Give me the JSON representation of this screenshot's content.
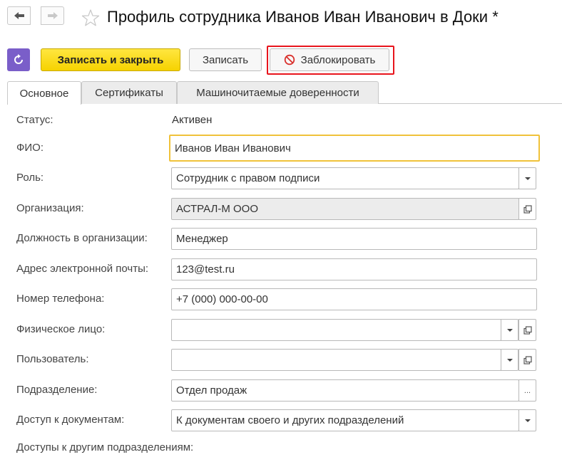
{
  "window": {
    "title": "Профиль сотрудника Иванов Иван Иванович в Доки *"
  },
  "toolbar": {
    "save_close_label": "Записать и закрыть",
    "save_label": "Записать",
    "block_label": "Заблокировать"
  },
  "tabs": [
    {
      "label": "Основное",
      "active": true
    },
    {
      "label": "Сертификаты",
      "active": false
    },
    {
      "label": "Машиночитаемые доверенности",
      "active": false
    }
  ],
  "form": {
    "status": {
      "label": "Статус:",
      "value": "Активен"
    },
    "fio": {
      "label": "ФИО:",
      "value": "Иванов Иван Иванович"
    },
    "role": {
      "label": "Роль:",
      "value": "Сотрудник с правом подписи"
    },
    "organization": {
      "label": "Организация:",
      "value": "АСТРАЛ-М ООО"
    },
    "position": {
      "label": "Должность в организации:",
      "value": "Менеджер"
    },
    "email": {
      "label": "Адрес электронной почты:",
      "value": "123@test.ru"
    },
    "phone": {
      "label": "Номер телефона:",
      "value": "+7 (000) 000-00-00"
    },
    "individual": {
      "label": "Физическое лицо:",
      "value": ""
    },
    "user": {
      "label": "Пользователь:",
      "value": ""
    },
    "department": {
      "label": "Подразделение:",
      "value": "Отдел продаж",
      "select_button": "..."
    },
    "document_access": {
      "label": "Доступ к документам:",
      "value": "К документам своего и других подразделений"
    },
    "other_departments": {
      "label": "Доступы к другим подразделениям:"
    }
  },
  "colors": {
    "primary_button": "#f6d200",
    "refresh_button": "#7a5ec9",
    "highlight_outline": "#e8141c",
    "block_icon": "#d9302c",
    "focus_border": "#f0c23a"
  },
  "icons": {
    "back": "arrow-left-icon",
    "forward": "arrow-right-icon",
    "favorite": "star-icon",
    "refresh": "refresh-icon",
    "block": "no-entry-icon",
    "open": "open-window-icon",
    "dropdown": "chevron-down-icon"
  }
}
